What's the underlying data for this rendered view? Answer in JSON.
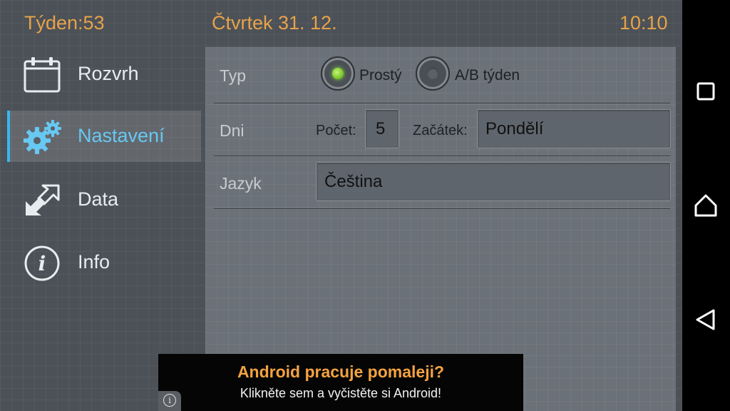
{
  "topbar": {
    "week": "Týden:53",
    "date": "Čtvrtek  31. 12.",
    "time": "10:10"
  },
  "sidebar": {
    "items": [
      {
        "label": "Rozvrh",
        "icon": "calendar-icon",
        "active": false
      },
      {
        "label": "Nastavení",
        "icon": "gears-icon",
        "active": true
      },
      {
        "label": "Data",
        "icon": "import-export-arrows-icon",
        "active": false
      },
      {
        "label": "Info",
        "icon": "info-icon",
        "active": false
      }
    ]
  },
  "settings": {
    "type_row": {
      "label": "Typ",
      "options": [
        "Prostý",
        "A/B týden"
      ],
      "selected": "Prostý"
    },
    "days_row": {
      "label": "Dni",
      "count_label": "Počet:",
      "count_value": "5",
      "start_label": "Začátek:",
      "start_value": "Pondělí"
    },
    "lang_row": {
      "label": "Jazyk",
      "value": "Čeština"
    }
  },
  "ad": {
    "headline": "Android pracuje pomaleji?",
    "subline": "Klikněte sem a vyčistěte si Android!",
    "info_icon": "info-icon"
  },
  "system_nav": {
    "buttons": [
      "recent-apps-icon",
      "home-icon",
      "back-icon"
    ]
  },
  "colors": {
    "accent_orange": "#e7a24a",
    "active_blue": "#39b6ee",
    "radio_green": "#8de03a"
  }
}
